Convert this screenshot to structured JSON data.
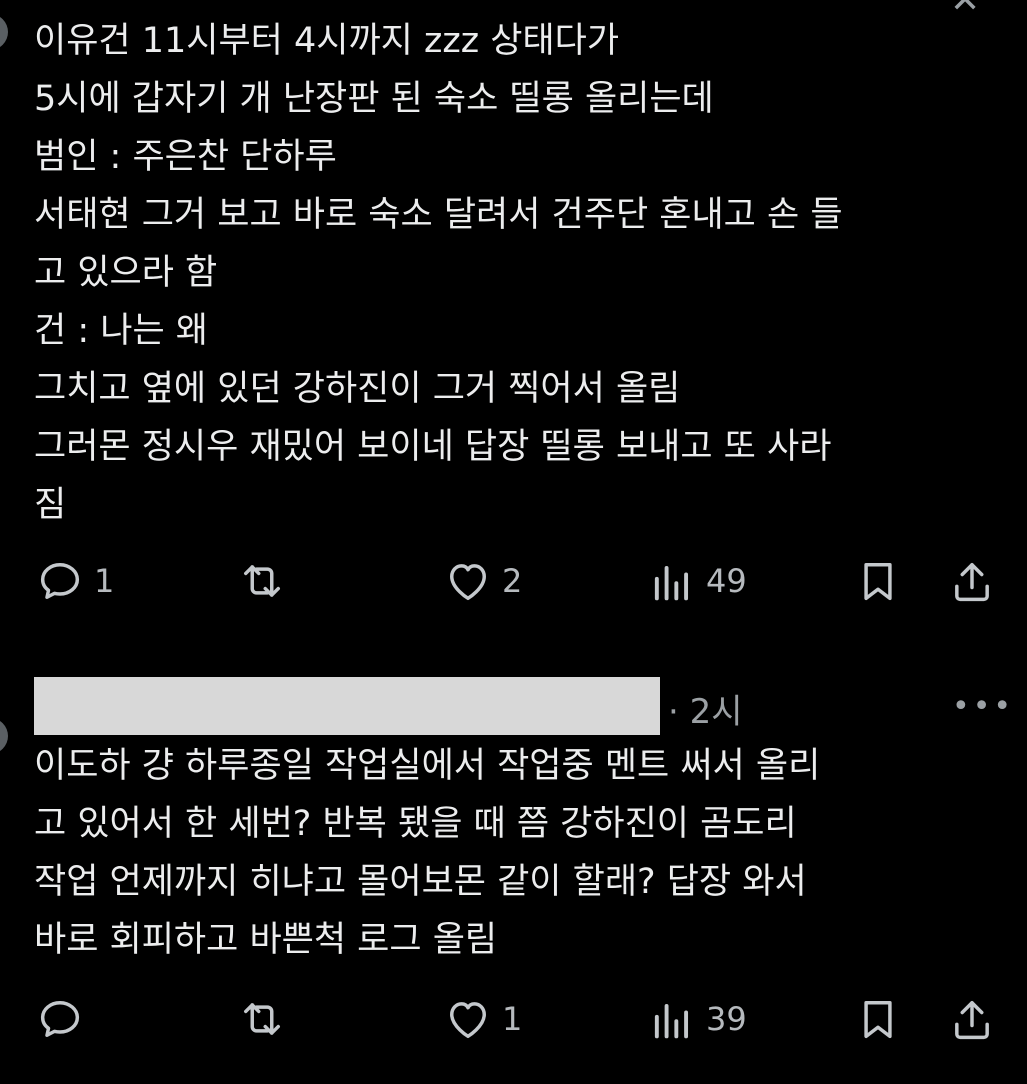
{
  "post1": {
    "lines": [
      "이유건 11시부터 4시까지 zzz 상태다가",
      "5시에 갑자기 개 난장판 된 숙소 띨롱 올리는데",
      "범인 : 주은찬 단하루",
      "서태현 그거 보고 바로 숙소 달려서 건주단 혼내고 손 들",
      "고 있으라 함",
      "건 : 나는 왜",
      "그치고 옆에 있던 강하진이 그거 찍어서 올림",
      "그러몬 정시우 재밌어 보이네 답장 띨롱 보내고 또 사라",
      "짐"
    ],
    "actions": {
      "reply_count": "1",
      "repost_count": "",
      "like_count": "2",
      "views_count": "49"
    }
  },
  "post2": {
    "time": "· 2시",
    "more": "•••",
    "lines": [
      "이도하 걍 하루종일 작업실에서 작업중 멘트 써서 올리",
      "고 있어서 한 세번? 반복 됐을 때 쯤 강하진이 곰도리",
      "작업 언제까지 히냐고 몰어보몬 같이 할래? 답장 와서",
      "바로 회피하고 바쁜척 로그 올림"
    ],
    "actions": {
      "reply_count": "",
      "repost_count": "",
      "like_count": "1",
      "views_count": "39"
    }
  },
  "icons": [
    "reply-icon",
    "repost-icon",
    "like-icon",
    "views-icon",
    "bookmark-icon",
    "share-icon"
  ],
  "colors": {
    "background": "#000000",
    "text": "#e7e9ea",
    "muted": "#9ba0a4",
    "redaction": "#d8d8d8"
  }
}
